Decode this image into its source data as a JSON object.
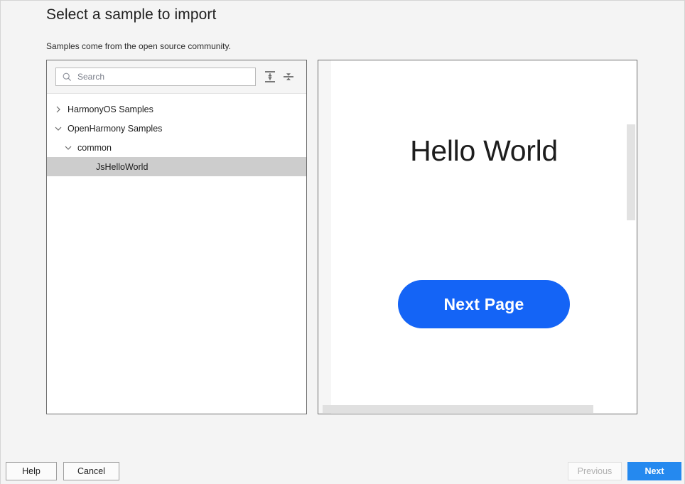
{
  "dialog": {
    "title": "Select a sample to import",
    "subtitle": "Samples come from the open source community."
  },
  "search": {
    "placeholder": "Search",
    "value": "",
    "icon": "search-icon"
  },
  "toolbar": {
    "expand_all_icon": "expand-all-icon",
    "collapse_all_icon": "collapse-all-icon"
  },
  "tree": {
    "items": [
      {
        "label": "HarmonyOS Samples",
        "level": 0,
        "state": "collapsed",
        "selected": false,
        "chevron": "chevron-right-icon"
      },
      {
        "label": "OpenHarmony Samples",
        "level": 0,
        "state": "expanded",
        "selected": false,
        "chevron": "chevron-down-icon"
      },
      {
        "label": "common",
        "level": 1,
        "state": "expanded",
        "selected": false,
        "chevron": "chevron-down-icon"
      },
      {
        "label": "JsHelloWorld",
        "level": 2,
        "state": "leaf",
        "selected": true,
        "chevron": ""
      }
    ]
  },
  "preview": {
    "heading": "Hello World",
    "button_label": "Next Page",
    "button_color": "#1464f6",
    "scrollbar_vertical": "vertical-scrollbar",
    "scrollbar_horizontal": "horizontal-scrollbar"
  },
  "footer": {
    "help_label": "Help",
    "cancel_label": "Cancel",
    "previous_label": "Previous",
    "previous_enabled": false,
    "next_label": "Next",
    "next_color": "#2589ef"
  }
}
